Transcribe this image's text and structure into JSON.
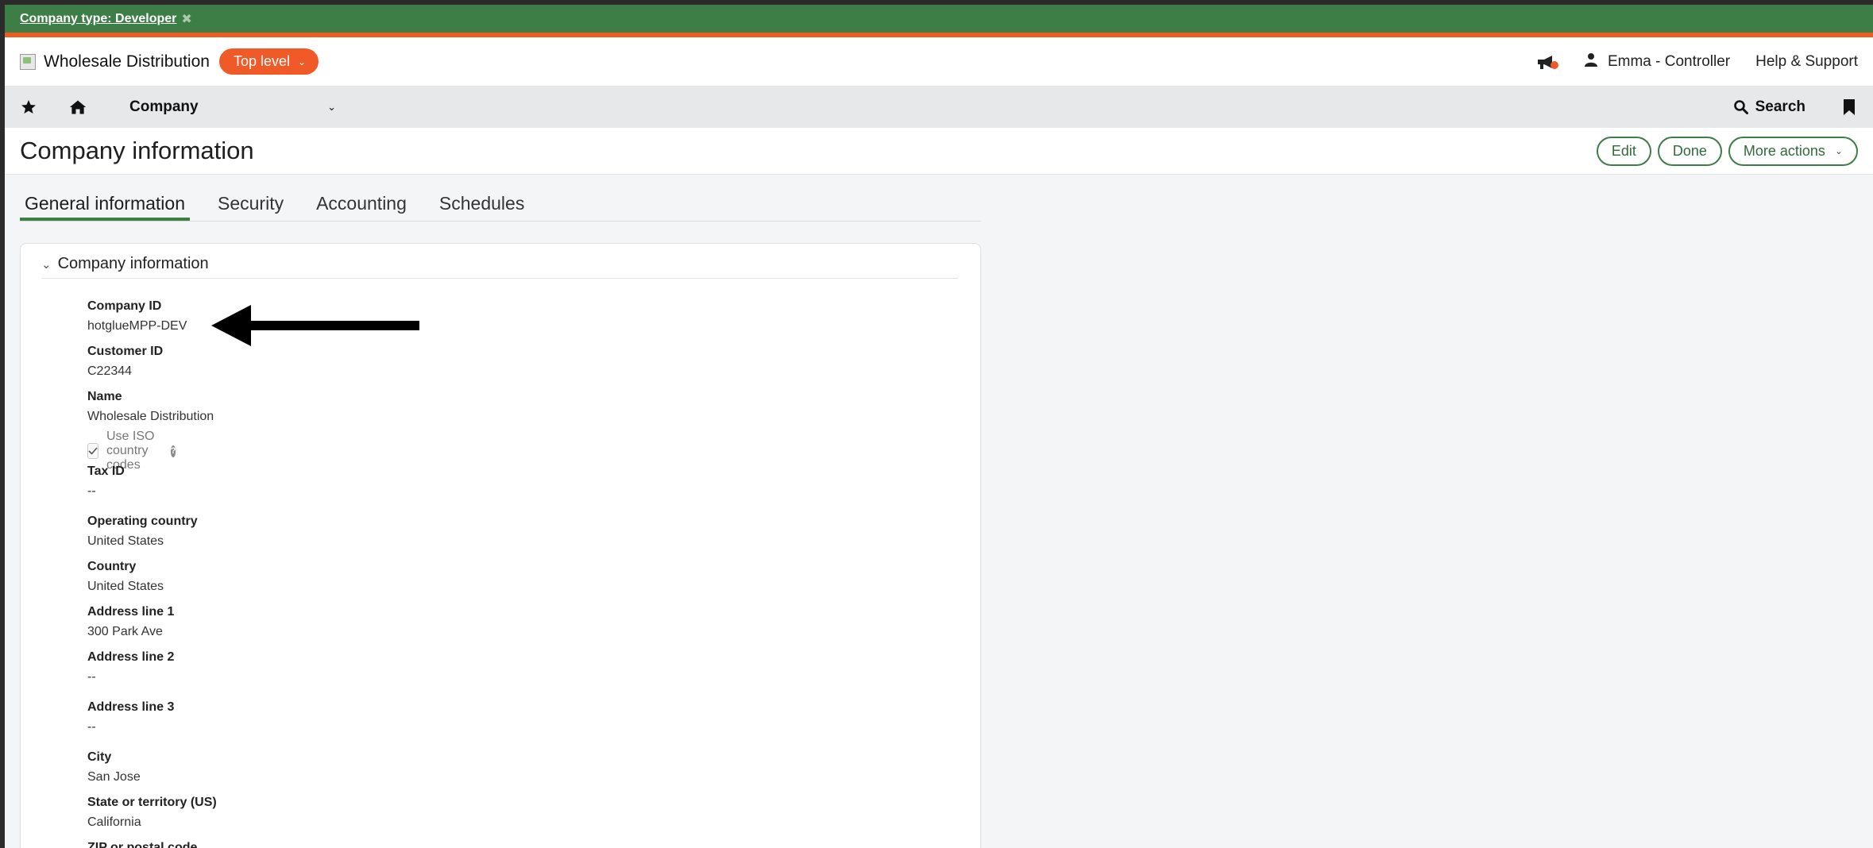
{
  "env_banner": {
    "label": "Company type: Developer",
    "close_glyph": "✖"
  },
  "header": {
    "company_name": "Wholesale Distribution",
    "level_pill": "Top level",
    "user": "Emma - Controller",
    "help": "Help & Support",
    "notification_icon": "megaphone-icon",
    "user_icon": "user-icon"
  },
  "nav": {
    "module": "Company",
    "search_label": "Search",
    "icons": [
      "star-icon",
      "home-icon",
      "chevron-down-icon",
      "search-icon",
      "bookmark-icon"
    ]
  },
  "page": {
    "title": "Company information",
    "actions": {
      "edit": "Edit",
      "done": "Done",
      "more": "More actions"
    }
  },
  "tabs": [
    {
      "label": "General information",
      "active": true
    },
    {
      "label": "Security",
      "active": false
    },
    {
      "label": "Accounting",
      "active": false
    },
    {
      "label": "Schedules",
      "active": false
    }
  ],
  "section": {
    "title": "Company information",
    "fields": [
      {
        "label": "Company ID",
        "value": "hotglueMPP-DEV"
      },
      {
        "label": "Customer ID",
        "value": "C22344"
      },
      {
        "label": "Name",
        "value": "Wholesale Distribution"
      },
      {
        "label": "Tax ID",
        "value": "--"
      },
      {
        "label": "Operating country",
        "value": "United States"
      },
      {
        "label": "Country",
        "value": "United States"
      },
      {
        "label": "Address line 1",
        "value": "300 Park Ave"
      },
      {
        "label": "Address line 2",
        "value": "--"
      },
      {
        "label": "Address line 3",
        "value": "--"
      },
      {
        "label": "City",
        "value": "San Jose"
      },
      {
        "label": "State or territory (US)",
        "value": "California"
      },
      {
        "label": "ZIP or postal code",
        "value": ""
      }
    ],
    "iso_checkbox": {
      "label": "Use ISO country codes",
      "checked": true,
      "help_glyph": "?"
    }
  },
  "colors": {
    "brand_green": "#3d7d46",
    "accent_orange": "#f05a28",
    "nav_gray": "#e6e8ea"
  }
}
